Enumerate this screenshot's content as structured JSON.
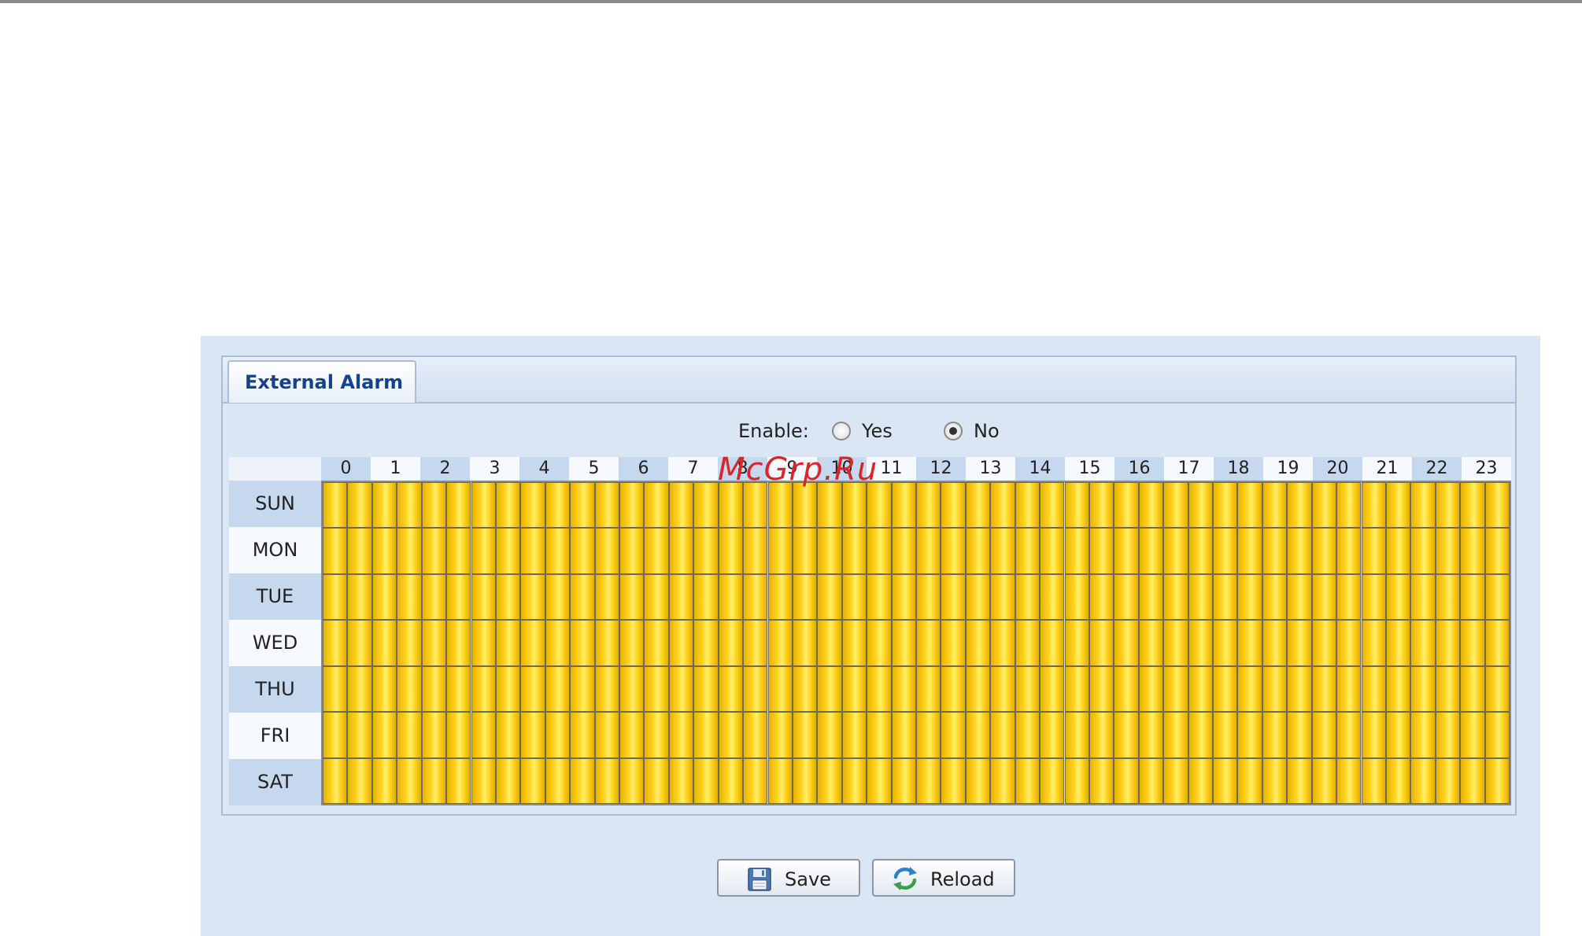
{
  "tab": {
    "label": "External Alarm"
  },
  "enable": {
    "label": "Enable:",
    "options": [
      {
        "label": "Yes",
        "checked": false
      },
      {
        "label": "No",
        "checked": true
      }
    ]
  },
  "schedule": {
    "hours": [
      "0",
      "1",
      "2",
      "3",
      "4",
      "5",
      "6",
      "7",
      "8",
      "9",
      "10",
      "11",
      "12",
      "13",
      "14",
      "15",
      "16",
      "17",
      "18",
      "19",
      "20",
      "21",
      "22",
      "23"
    ],
    "days": [
      "SUN",
      "MON",
      "TUE",
      "WED",
      "THU",
      "FRI",
      "SAT"
    ],
    "cells_per_hour": 2,
    "all_cells_selected": true,
    "selected_color": "#ffd21f"
  },
  "buttons": {
    "save": "Save",
    "reload": "Reload"
  },
  "watermark": "McGrp.Ru",
  "colors": {
    "panel_bg": "#dbe6f4",
    "header_blue": "#c5d8ee",
    "tab_text": "#15428b"
  }
}
